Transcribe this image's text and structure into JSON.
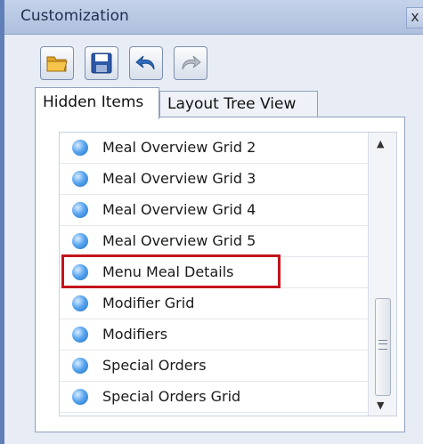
{
  "window": {
    "title": "Customization",
    "close_label": "x"
  },
  "toolbar": {
    "buttons": [
      {
        "name": "open-folder-button",
        "icon": "folder-open-icon"
      },
      {
        "name": "save-button",
        "icon": "floppy-disk-icon"
      },
      {
        "name": "undo-button",
        "icon": "undo-arrow-icon"
      },
      {
        "name": "redo-button",
        "icon": "redo-arrow-icon",
        "disabled": true
      }
    ]
  },
  "tabs": [
    {
      "label": "Hidden Items",
      "active": true
    },
    {
      "label": "Layout Tree View",
      "active": false
    }
  ],
  "list": {
    "items": [
      {
        "label": "Meal Overview Grid 2"
      },
      {
        "label": "Meal Overview Grid 3"
      },
      {
        "label": "Meal Overview Grid 4"
      },
      {
        "label": "Meal Overview Grid 5"
      },
      {
        "label": "Menu Meal Details",
        "highlighted": true
      },
      {
        "label": "Modifier Grid"
      },
      {
        "label": "Modifiers"
      },
      {
        "label": "Special Orders"
      },
      {
        "label": "Special Orders Grid"
      }
    ],
    "highlight_color": "#c3141c"
  }
}
